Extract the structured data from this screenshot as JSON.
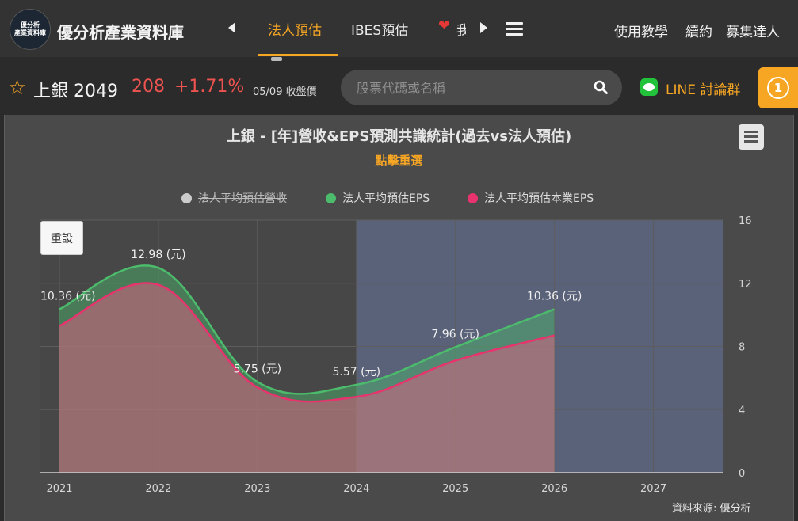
{
  "nav": {
    "logo_line1": "優分析",
    "logo_line2": "產業資料庫",
    "site_title": "優分析產業資料庫",
    "tabs": [
      "法人預估",
      "IBES預估"
    ],
    "partial_tab": "我",
    "links": [
      "使用教學",
      "續約",
      "募集達人"
    ]
  },
  "stock": {
    "name": "上銀 2049",
    "price": "208",
    "change": "+1.71%",
    "date": "05/09 收盤價"
  },
  "search": {
    "placeholder": "股票代碼或名稱"
  },
  "line_group": {
    "label": "LINE 討論群"
  },
  "notification": {
    "count": "1"
  },
  "colors": {
    "accent": "#f6a623",
    "up": "#ef5350",
    "eps": "#4cbb6c",
    "core_eps": "#e8336e"
  },
  "chart_data": {
    "type": "area",
    "title": "上銀 - [年]營收&EPS預測共識統計(過去vs法人預估)",
    "subtitle": "點擊重選",
    "reset_label": "重設",
    "source": "資料來源: 優分析",
    "x": [
      2021,
      2022,
      2023,
      2024,
      2025,
      2026
    ],
    "x_ticks": [
      "2021",
      "2022",
      "2023",
      "2024",
      "2025",
      "2026",
      "2027"
    ],
    "xlim": [
      2020.8,
      2027.7
    ],
    "y_right_ticks": [
      "0",
      "4",
      "8",
      "12",
      "16"
    ],
    "ylim": [
      0,
      16
    ],
    "forecast_shade_range": [
      2024,
      2027.7
    ],
    "legend": [
      {
        "name": "法人平均預估營收",
        "color": "#cccccc",
        "hidden": true
      },
      {
        "name": "法人平均預估EPS",
        "color": "#4cbb6c",
        "hidden": false
      },
      {
        "name": "法人平均預估本業EPS",
        "color": "#e8336e",
        "hidden": false
      }
    ],
    "series": [
      {
        "name": "法人平均預估EPS",
        "values": [
          10.36,
          12.98,
          5.75,
          5.57,
          7.96,
          10.36
        ]
      },
      {
        "name": "法人平均預估本業EPS",
        "values": [
          9.3,
          11.9,
          5.4,
          4.8,
          7.1,
          8.7
        ]
      }
    ],
    "data_labels": [
      "10.36 (元)",
      "12.98 (元)",
      "5.75 (元)",
      "5.57 (元)",
      "7.96 (元)",
      "10.36 (元)"
    ]
  }
}
